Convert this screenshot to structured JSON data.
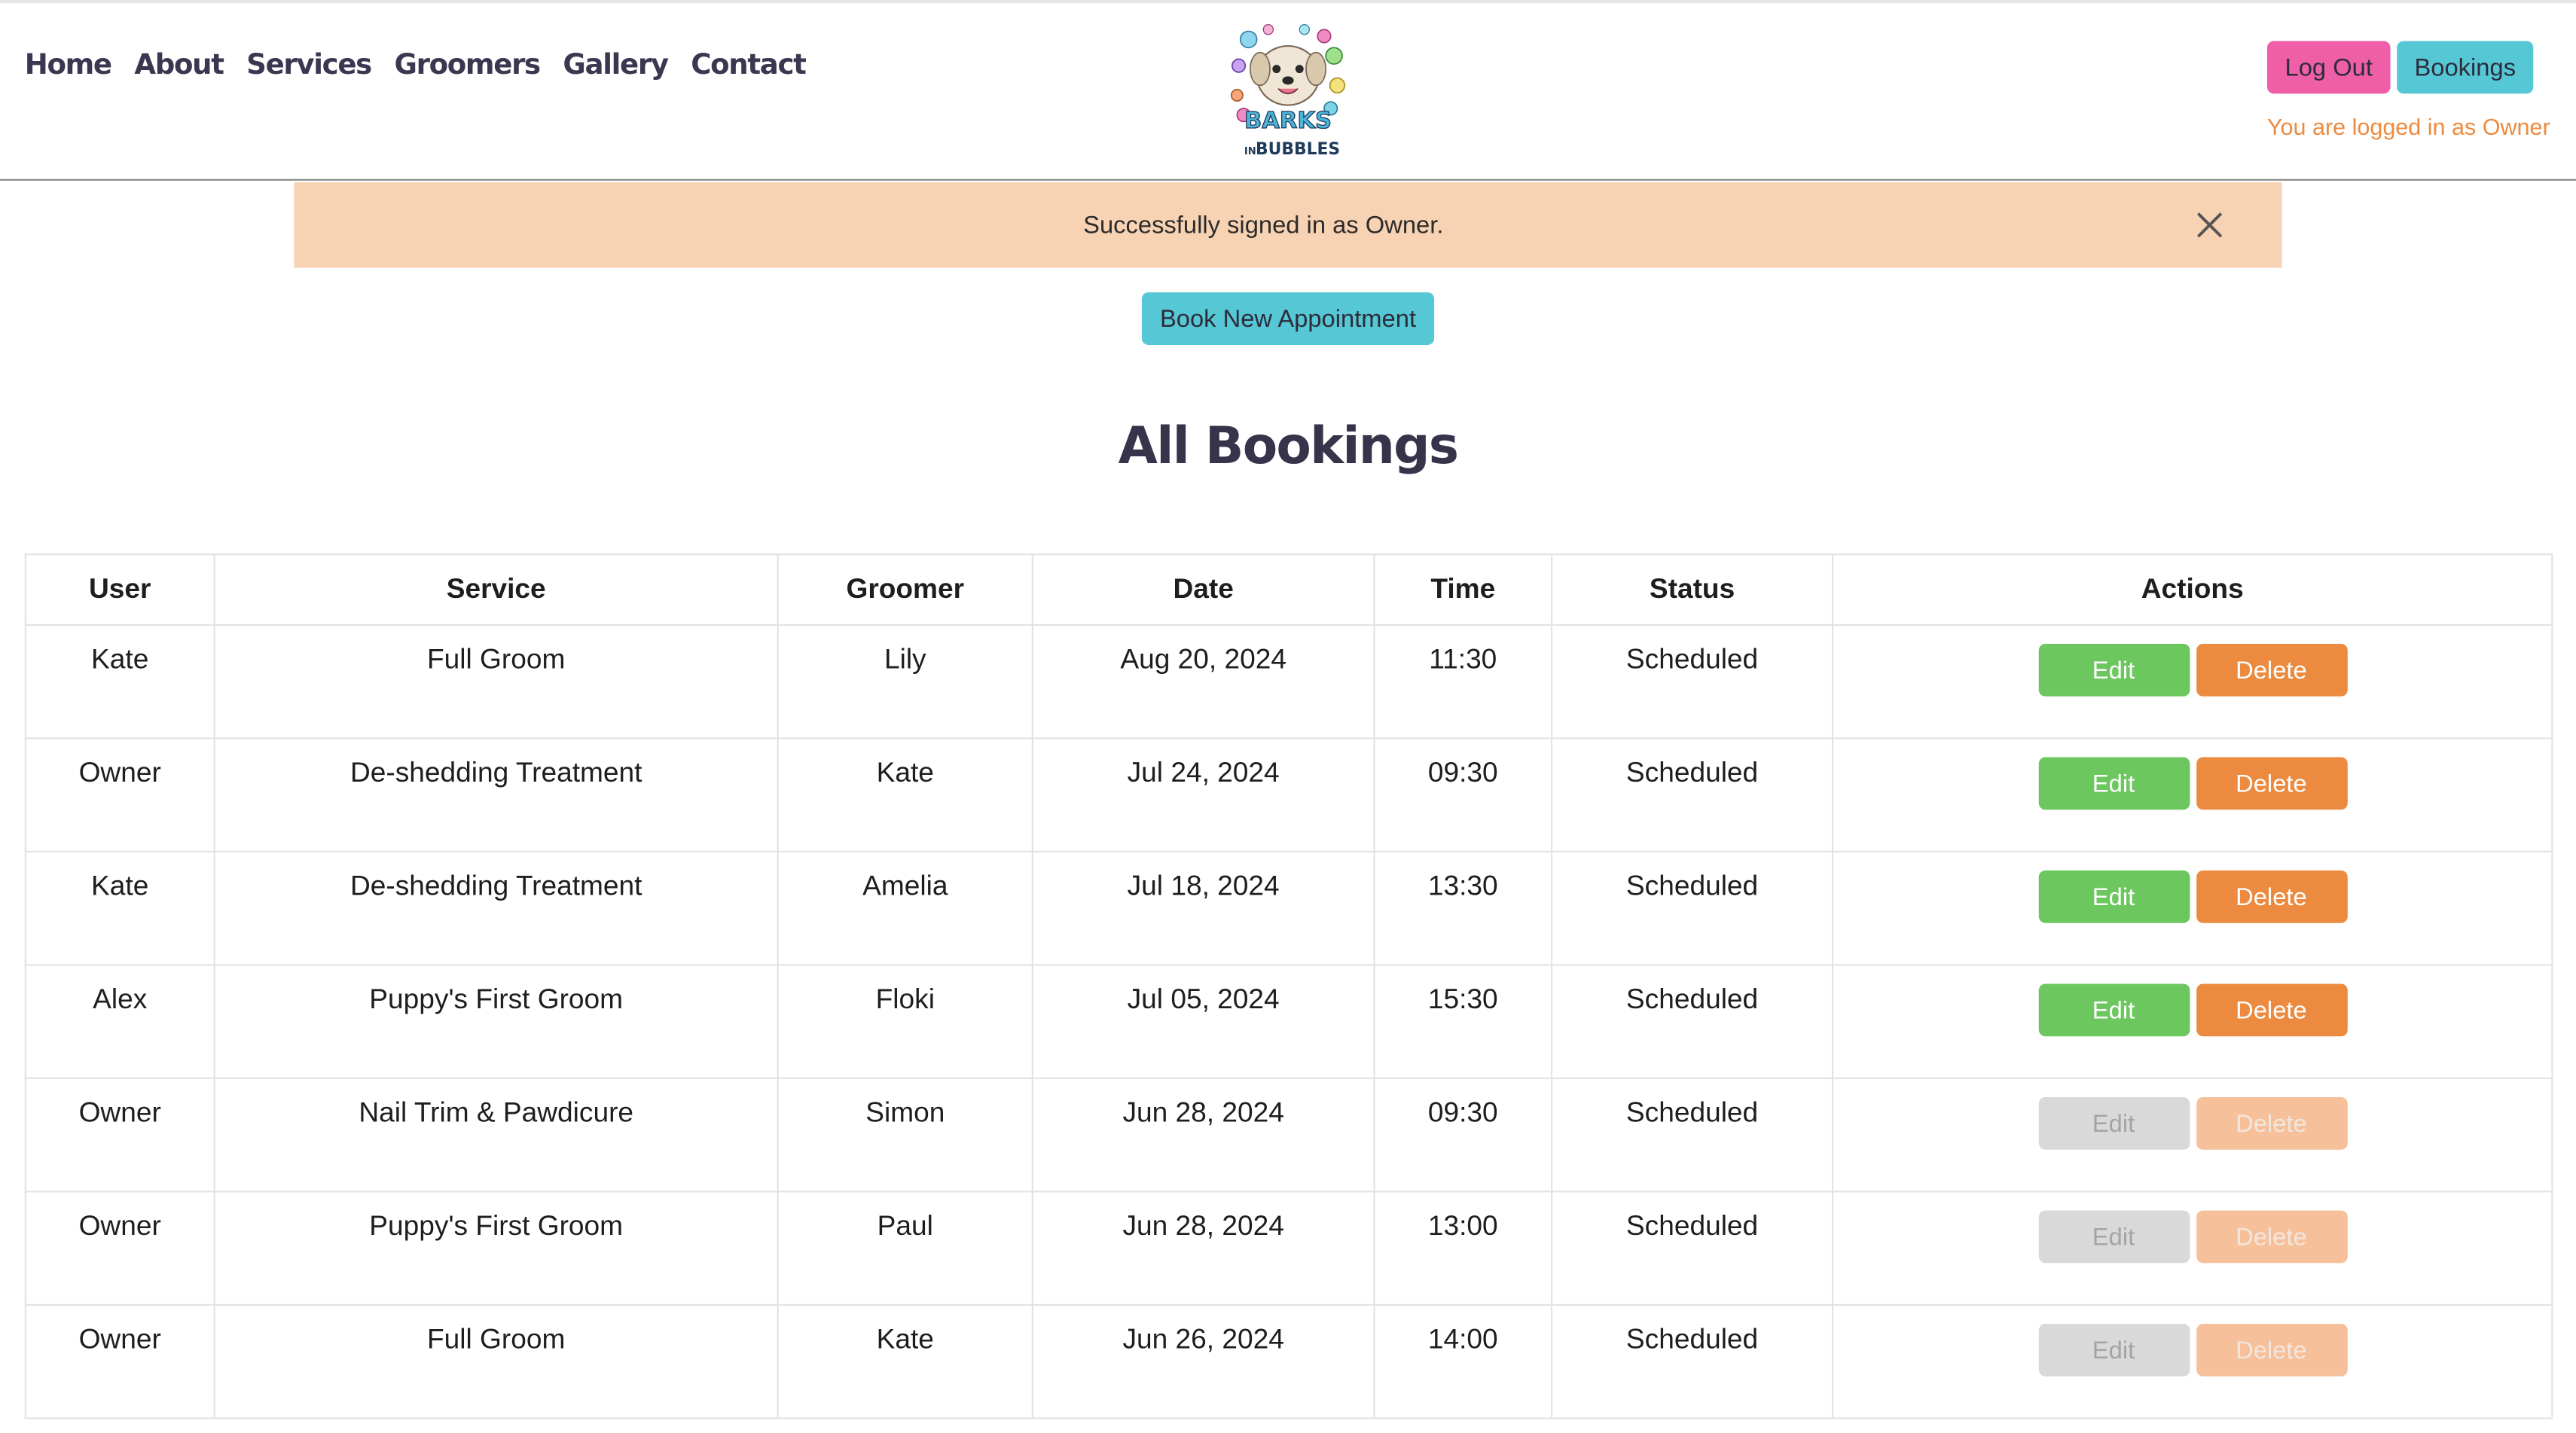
{
  "nav": {
    "items": [
      {
        "label": "Home"
      },
      {
        "label": "About"
      },
      {
        "label": "Services"
      },
      {
        "label": "Groomers"
      },
      {
        "label": "Gallery"
      },
      {
        "label": "Contact"
      }
    ]
  },
  "logo": {
    "text_top": "BARKS",
    "text_small": "IN",
    "text_bottom": "BUBBLES"
  },
  "header": {
    "logout_label": "Log Out",
    "bookings_label": "Bookings",
    "logged_in_note": "You are logged in as Owner"
  },
  "alert": {
    "message": "Successfully signed in as Owner."
  },
  "book_button": "Book New Appointment",
  "page_title": "All Bookings",
  "table": {
    "headers": [
      "User",
      "Service",
      "Groomer",
      "Date",
      "Time",
      "Status",
      "Actions"
    ],
    "rows": [
      {
        "user": "Kate",
        "service": "Full Groom",
        "groomer": "Lily",
        "date": "Aug 20, 2024",
        "time": "11:30",
        "status": "Scheduled",
        "actions_enabled": true
      },
      {
        "user": "Owner",
        "service": "De-shedding Treatment",
        "groomer": "Kate",
        "date": "Jul 24, 2024",
        "time": "09:30",
        "status": "Scheduled",
        "actions_enabled": true
      },
      {
        "user": "Kate",
        "service": "De-shedding Treatment",
        "groomer": "Amelia",
        "date": "Jul 18, 2024",
        "time": "13:30",
        "status": "Scheduled",
        "actions_enabled": true
      },
      {
        "user": "Alex",
        "service": "Puppy's First Groom",
        "groomer": "Floki",
        "date": "Jul 05, 2024",
        "time": "15:30",
        "status": "Scheduled",
        "actions_enabled": true
      },
      {
        "user": "Owner",
        "service": "Nail Trim & Pawdicure",
        "groomer": "Simon",
        "date": "Jun 28, 2024",
        "time": "09:30",
        "status": "Scheduled",
        "actions_enabled": false
      },
      {
        "user": "Owner",
        "service": "Puppy's First Groom",
        "groomer": "Paul",
        "date": "Jun 28, 2024",
        "time": "13:00",
        "status": "Scheduled",
        "actions_enabled": false
      },
      {
        "user": "Owner",
        "service": "Full Groom",
        "groomer": "Kate",
        "date": "Jun 26, 2024",
        "time": "14:00",
        "status": "Scheduled",
        "actions_enabled": false
      }
    ],
    "edit_label": "Edit",
    "delete_label": "Delete"
  },
  "colors": {
    "pink_button": "#ef5fa7",
    "teal_button": "#56c7d4",
    "edit_green": "#6cc75e",
    "delete_orange": "#ec8b3f",
    "alert_bg": "#f8d3b3",
    "title_navy": "#36344a"
  }
}
